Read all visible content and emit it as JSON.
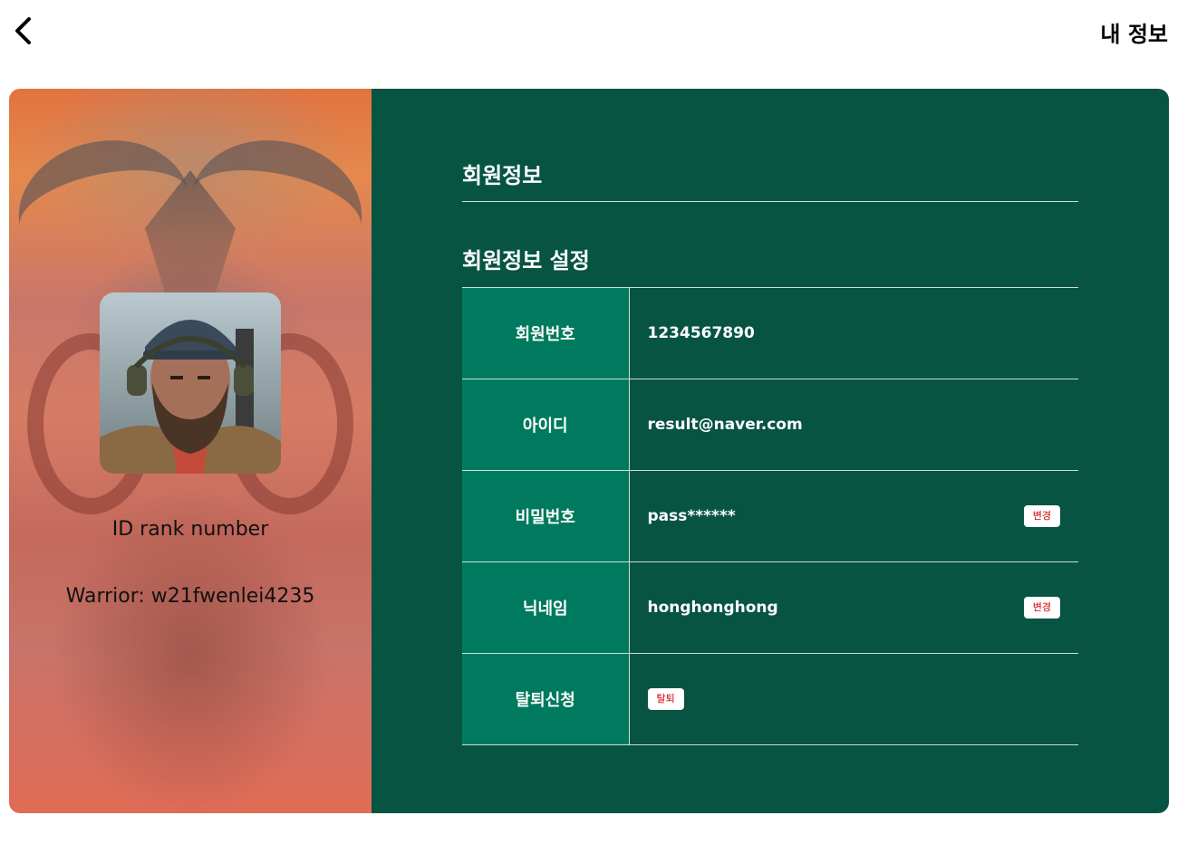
{
  "header": {
    "back_icon": "chevron-left-icon",
    "title": "내 정보"
  },
  "profile": {
    "rank_label": "ID rank number",
    "warrior_label": "Warrior: w21fwenlei4235"
  },
  "section": {
    "member_info_title": "회원정보",
    "settings_title": "회원정보 설정"
  },
  "rows": [
    {
      "label": "회원번호",
      "value": "1234567890"
    },
    {
      "label": "아이디",
      "value": "result@naver.com"
    },
    {
      "label": "비밀번호",
      "value": "pass******",
      "button": "변경"
    },
    {
      "label": "닉네임",
      "value": "honghonghong",
      "button": "변경"
    },
    {
      "label": "탈퇴신청",
      "button": "탈퇴"
    }
  ],
  "colors": {
    "panel": "#075443",
    "label_cell": "#007a5e",
    "button_text": "#d10000"
  }
}
